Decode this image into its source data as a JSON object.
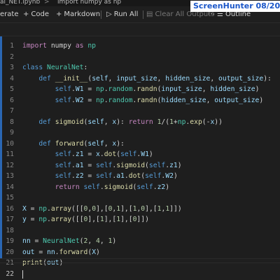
{
  "titlebar": {
    "file_tab": "al_NET.ipynb",
    "separator": ">",
    "cell_tab": "import numpy as np"
  },
  "toolbar": {
    "generate": "erate",
    "code_label": "Code",
    "markdown_label": "Markdown",
    "run_all_label": "Run All",
    "clear_outputs_label": "Clear All Outputs",
    "outline_label": "Outline"
  },
  "watermark": "ScreenHunter  08/20",
  "editor": {
    "lines": [
      {
        "n": "1",
        "tokens": [
          {
            "t": "import",
            "c": "kw"
          },
          {
            "t": " numpy ",
            "c": "pl"
          },
          {
            "t": "as",
            "c": "kw"
          },
          {
            "t": " np",
            "c": "cls"
          }
        ]
      },
      {
        "n": "2",
        "tokens": []
      },
      {
        "n": "3",
        "tokens": [
          {
            "t": "class",
            "c": "kd"
          },
          {
            "t": " ",
            "c": "pl"
          },
          {
            "t": "NeuralNet",
            "c": "cls"
          },
          {
            "t": ":",
            "c": "pl"
          }
        ]
      },
      {
        "n": "4",
        "tokens": [
          {
            "t": "    ",
            "c": "pl"
          },
          {
            "t": "def",
            "c": "kd"
          },
          {
            "t": " ",
            "c": "pl"
          },
          {
            "t": "__init__",
            "c": "fn"
          },
          {
            "t": "(",
            "c": "pl"
          },
          {
            "t": "self",
            "c": "var"
          },
          {
            "t": ", ",
            "c": "pl"
          },
          {
            "t": "input_size",
            "c": "var"
          },
          {
            "t": ", ",
            "c": "pl"
          },
          {
            "t": "hidden_size",
            "c": "var"
          },
          {
            "t": ", ",
            "c": "pl"
          },
          {
            "t": "output_size",
            "c": "var"
          },
          {
            "t": "):",
            "c": "pl"
          }
        ]
      },
      {
        "n": "5",
        "tokens": [
          {
            "t": "        ",
            "c": "pl"
          },
          {
            "t": "self",
            "c": "self"
          },
          {
            "t": ".",
            "c": "pl"
          },
          {
            "t": "W1",
            "c": "var"
          },
          {
            "t": " = ",
            "c": "pl"
          },
          {
            "t": "np",
            "c": "cls"
          },
          {
            "t": ".",
            "c": "pl"
          },
          {
            "t": "random",
            "c": "cls"
          },
          {
            "t": ".",
            "c": "pl"
          },
          {
            "t": "randn",
            "c": "fn"
          },
          {
            "t": "(",
            "c": "pl"
          },
          {
            "t": "input_size",
            "c": "var"
          },
          {
            "t": ", ",
            "c": "pl"
          },
          {
            "t": "hidden_size",
            "c": "var"
          },
          {
            "t": ")",
            "c": "pl"
          }
        ]
      },
      {
        "n": "6",
        "tokens": [
          {
            "t": "        ",
            "c": "pl"
          },
          {
            "t": "self",
            "c": "self"
          },
          {
            "t": ".",
            "c": "pl"
          },
          {
            "t": "W2",
            "c": "var"
          },
          {
            "t": " = ",
            "c": "pl"
          },
          {
            "t": "np",
            "c": "cls"
          },
          {
            "t": ".",
            "c": "pl"
          },
          {
            "t": "random",
            "c": "cls"
          },
          {
            "t": ".",
            "c": "pl"
          },
          {
            "t": "randn",
            "c": "fn"
          },
          {
            "t": "(",
            "c": "pl"
          },
          {
            "t": "hidden_size",
            "c": "var"
          },
          {
            "t": ", ",
            "c": "pl"
          },
          {
            "t": "output_size",
            "c": "var"
          },
          {
            "t": ")",
            "c": "pl"
          }
        ]
      },
      {
        "n": "7",
        "tokens": []
      },
      {
        "n": "8",
        "tokens": [
          {
            "t": "    ",
            "c": "pl"
          },
          {
            "t": "def",
            "c": "kd"
          },
          {
            "t": " ",
            "c": "pl"
          },
          {
            "t": "sigmoid",
            "c": "fn"
          },
          {
            "t": "(",
            "c": "pl"
          },
          {
            "t": "self",
            "c": "var"
          },
          {
            "t": ", ",
            "c": "pl"
          },
          {
            "t": "x",
            "c": "var"
          },
          {
            "t": "): ",
            "c": "pl"
          },
          {
            "t": "return",
            "c": "kw"
          },
          {
            "t": " ",
            "c": "pl"
          },
          {
            "t": "1",
            "c": "num"
          },
          {
            "t": "/(",
            "c": "pl"
          },
          {
            "t": "1",
            "c": "num"
          },
          {
            "t": "+",
            "c": "pl"
          },
          {
            "t": "np",
            "c": "cls"
          },
          {
            "t": ".",
            "c": "pl"
          },
          {
            "t": "exp",
            "c": "fn"
          },
          {
            "t": "(-",
            "c": "pl"
          },
          {
            "t": "x",
            "c": "var"
          },
          {
            "t": "))",
            "c": "pl"
          }
        ]
      },
      {
        "n": "9",
        "tokens": []
      },
      {
        "n": "10",
        "tokens": [
          {
            "t": "    ",
            "c": "pl"
          },
          {
            "t": "def",
            "c": "kd"
          },
          {
            "t": " ",
            "c": "pl"
          },
          {
            "t": "forward",
            "c": "fn"
          },
          {
            "t": "(",
            "c": "pl"
          },
          {
            "t": "self",
            "c": "var"
          },
          {
            "t": ", ",
            "c": "pl"
          },
          {
            "t": "x",
            "c": "var"
          },
          {
            "t": "):",
            "c": "pl"
          }
        ]
      },
      {
        "n": "11",
        "tokens": [
          {
            "t": "        ",
            "c": "pl"
          },
          {
            "t": "self",
            "c": "self"
          },
          {
            "t": ".",
            "c": "pl"
          },
          {
            "t": "z1",
            "c": "var"
          },
          {
            "t": " = ",
            "c": "pl"
          },
          {
            "t": "x",
            "c": "var"
          },
          {
            "t": ".",
            "c": "pl"
          },
          {
            "t": "dot",
            "c": "fn"
          },
          {
            "t": "(",
            "c": "pl"
          },
          {
            "t": "self",
            "c": "self"
          },
          {
            "t": ".",
            "c": "pl"
          },
          {
            "t": "W1",
            "c": "var"
          },
          {
            "t": ")",
            "c": "pl"
          }
        ]
      },
      {
        "n": "12",
        "tokens": [
          {
            "t": "        ",
            "c": "pl"
          },
          {
            "t": "self",
            "c": "self"
          },
          {
            "t": ".",
            "c": "pl"
          },
          {
            "t": "a1",
            "c": "var"
          },
          {
            "t": " = ",
            "c": "pl"
          },
          {
            "t": "self",
            "c": "self"
          },
          {
            "t": ".",
            "c": "pl"
          },
          {
            "t": "sigmoid",
            "c": "fn"
          },
          {
            "t": "(",
            "c": "pl"
          },
          {
            "t": "self",
            "c": "self"
          },
          {
            "t": ".",
            "c": "pl"
          },
          {
            "t": "z1",
            "c": "var"
          },
          {
            "t": ")",
            "c": "pl"
          }
        ]
      },
      {
        "n": "13",
        "tokens": [
          {
            "t": "        ",
            "c": "pl"
          },
          {
            "t": "self",
            "c": "self"
          },
          {
            "t": ".",
            "c": "pl"
          },
          {
            "t": "z2",
            "c": "var"
          },
          {
            "t": " = ",
            "c": "pl"
          },
          {
            "t": "self",
            "c": "self"
          },
          {
            "t": ".",
            "c": "pl"
          },
          {
            "t": "a1",
            "c": "var"
          },
          {
            "t": ".",
            "c": "pl"
          },
          {
            "t": "dot",
            "c": "fn"
          },
          {
            "t": "(",
            "c": "pl"
          },
          {
            "t": "self",
            "c": "self"
          },
          {
            "t": ".",
            "c": "pl"
          },
          {
            "t": "W2",
            "c": "var"
          },
          {
            "t": ")",
            "c": "pl"
          }
        ]
      },
      {
        "n": "14",
        "tokens": [
          {
            "t": "        ",
            "c": "pl"
          },
          {
            "t": "return",
            "c": "kw"
          },
          {
            "t": " ",
            "c": "pl"
          },
          {
            "t": "self",
            "c": "self"
          },
          {
            "t": ".",
            "c": "pl"
          },
          {
            "t": "sigmoid",
            "c": "fn"
          },
          {
            "t": "(",
            "c": "pl"
          },
          {
            "t": "self",
            "c": "self"
          },
          {
            "t": ".",
            "c": "pl"
          },
          {
            "t": "z2",
            "c": "var"
          },
          {
            "t": ")",
            "c": "pl"
          }
        ]
      },
      {
        "n": "15",
        "tokens": []
      },
      {
        "n": "16",
        "tokens": [
          {
            "t": "X",
            "c": "var"
          },
          {
            "t": " = ",
            "c": "pl"
          },
          {
            "t": "np",
            "c": "cls"
          },
          {
            "t": ".",
            "c": "pl"
          },
          {
            "t": "array",
            "c": "fn"
          },
          {
            "t": "([[",
            "c": "pl"
          },
          {
            "t": "0",
            "c": "num"
          },
          {
            "t": ",",
            "c": "pl"
          },
          {
            "t": "0",
            "c": "num"
          },
          {
            "t": "],[",
            "c": "pl"
          },
          {
            "t": "0",
            "c": "num"
          },
          {
            "t": ",",
            "c": "pl"
          },
          {
            "t": "1",
            "c": "num"
          },
          {
            "t": "],[",
            "c": "pl"
          },
          {
            "t": "1",
            "c": "num"
          },
          {
            "t": ",",
            "c": "pl"
          },
          {
            "t": "0",
            "c": "num"
          },
          {
            "t": "],[",
            "c": "pl"
          },
          {
            "t": "1",
            "c": "num"
          },
          {
            "t": ",",
            "c": "pl"
          },
          {
            "t": "1",
            "c": "num"
          },
          {
            "t": "]])",
            "c": "pl"
          }
        ]
      },
      {
        "n": "17",
        "tokens": [
          {
            "t": "y",
            "c": "var"
          },
          {
            "t": " = ",
            "c": "pl"
          },
          {
            "t": "np",
            "c": "cls"
          },
          {
            "t": ".",
            "c": "pl"
          },
          {
            "t": "array",
            "c": "fn"
          },
          {
            "t": "([[",
            "c": "pl"
          },
          {
            "t": "0",
            "c": "num"
          },
          {
            "t": "],[",
            "c": "pl"
          },
          {
            "t": "1",
            "c": "num"
          },
          {
            "t": "],[",
            "c": "pl"
          },
          {
            "t": "1",
            "c": "num"
          },
          {
            "t": "],[",
            "c": "pl"
          },
          {
            "t": "0",
            "c": "num"
          },
          {
            "t": "]])",
            "c": "pl"
          }
        ]
      },
      {
        "n": "18",
        "tokens": []
      },
      {
        "n": "19",
        "tokens": [
          {
            "t": "nn",
            "c": "var"
          },
          {
            "t": " = ",
            "c": "pl"
          },
          {
            "t": "NeuralNet",
            "c": "cls"
          },
          {
            "t": "(",
            "c": "pl"
          },
          {
            "t": "2",
            "c": "num"
          },
          {
            "t": ", ",
            "c": "pl"
          },
          {
            "t": "4",
            "c": "num"
          },
          {
            "t": ", ",
            "c": "pl"
          },
          {
            "t": "1",
            "c": "num"
          },
          {
            "t": ")",
            "c": "pl"
          }
        ]
      },
      {
        "n": "20",
        "tokens": [
          {
            "t": "out",
            "c": "var"
          },
          {
            "t": " = ",
            "c": "pl"
          },
          {
            "t": "nn",
            "c": "var"
          },
          {
            "t": ".",
            "c": "pl"
          },
          {
            "t": "forward",
            "c": "fn"
          },
          {
            "t": "(",
            "c": "pl"
          },
          {
            "t": "X",
            "c": "var"
          },
          {
            "t": ")",
            "c": "pl"
          }
        ]
      },
      {
        "n": "21",
        "tokens": [
          {
            "t": "print",
            "c": "fn"
          },
          {
            "t": "(",
            "c": "pl"
          },
          {
            "t": "out",
            "c": "var"
          },
          {
            "t": ")",
            "c": "pl"
          }
        ]
      },
      {
        "n": "22",
        "tokens": [],
        "active": true
      }
    ]
  }
}
